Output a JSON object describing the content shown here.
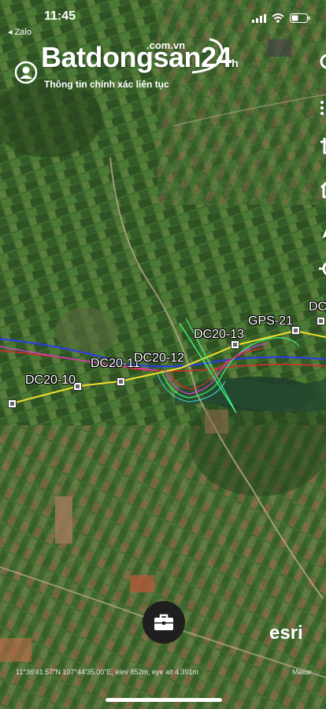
{
  "status_bar": {
    "time": "11:45",
    "back_app": "◂ Zalo"
  },
  "brand": {
    "name": "Batdongsan24",
    "name_part1": "Batdongsan",
    "name_part2": "24",
    "name_suffix": "h",
    "domain": ".com.vn",
    "tagline": "Thông tin chính xác liên tục"
  },
  "map": {
    "points": [
      {
        "label": "DC20-10"
      },
      {
        "label": "DC20-11"
      },
      {
        "label": "DC20-12"
      },
      {
        "label": "DC20-13"
      },
      {
        "label": "GPS-21"
      },
      {
        "label": "DC"
      }
    ],
    "coordinates": "11°36'41.57\"N 107°44'35.00\"E, elev 852m, eye alt 4.391m",
    "attribution": "Maxar",
    "watermark": "esri"
  },
  "tools": [
    "search-icon",
    "list-icon",
    "crop-icon",
    "home-icon",
    "navigate-icon",
    "locate-icon"
  ],
  "colors": {
    "route_yellow": "#f2e02a",
    "route_blue": "#2a3cf0",
    "route_red": "#e02a2a",
    "route_green": "#3ef07a",
    "route_magenta": "#e03ae0"
  }
}
